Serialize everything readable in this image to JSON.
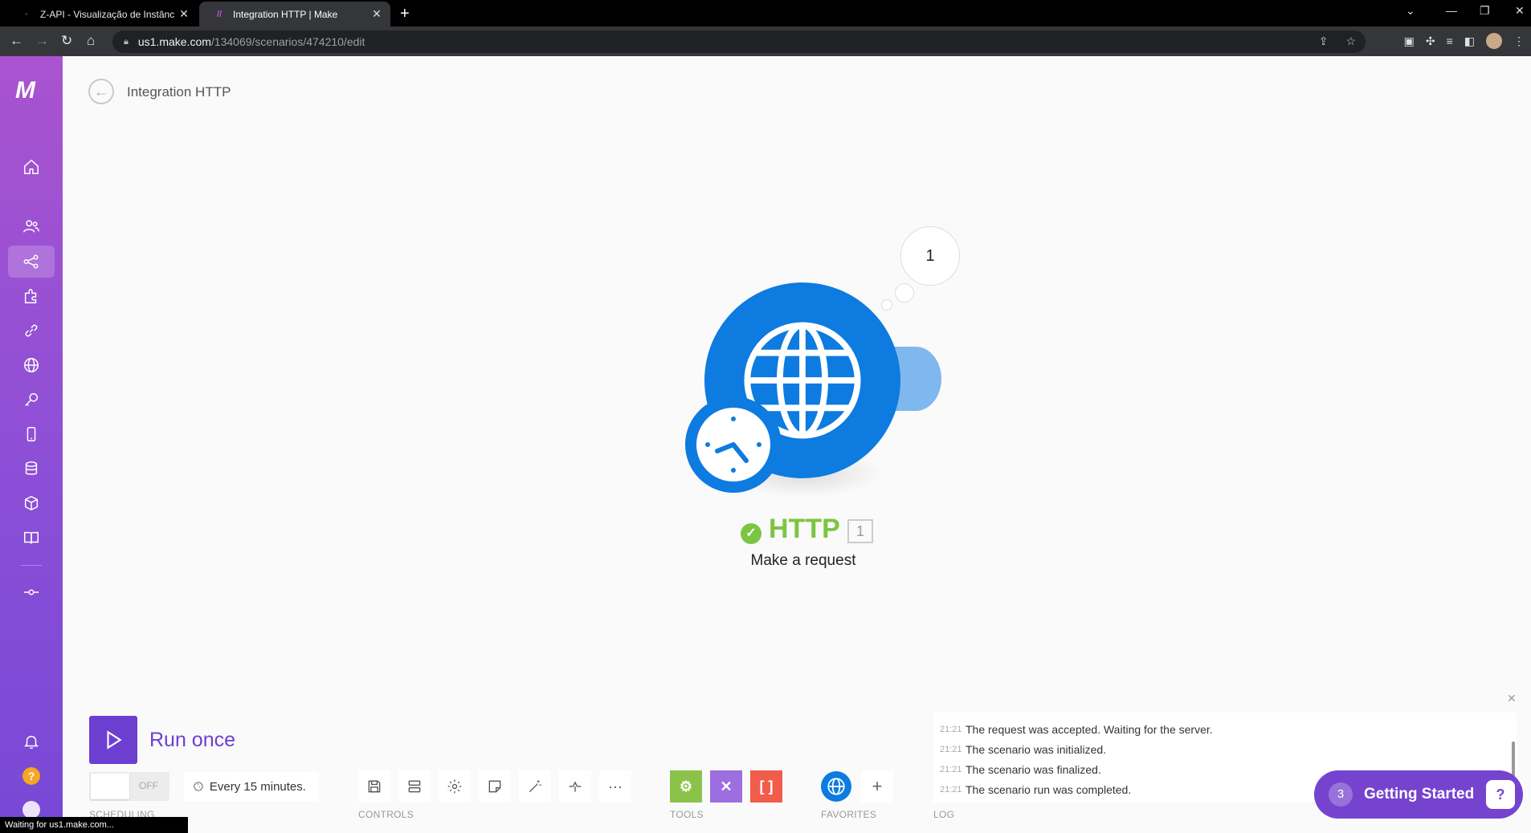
{
  "browser": {
    "tabs": [
      {
        "title": "Z-API - Visualização de Instância",
        "active": false
      },
      {
        "title": "Integration HTTP | Make",
        "active": true
      }
    ],
    "url_host": "us1.make.com",
    "url_path": "/134069/scenarios/474210/edit",
    "status_text": "Waiting for us1.make.com..."
  },
  "sidebar": {
    "logo": "M",
    "items": [
      {
        "icon": "home-icon"
      },
      {
        "icon": "team-icon"
      },
      {
        "icon": "scenarios-icon",
        "active": true
      },
      {
        "icon": "templates-icon"
      },
      {
        "icon": "connections-icon"
      },
      {
        "icon": "webhooks-icon"
      },
      {
        "icon": "keys-icon"
      },
      {
        "icon": "devices-icon"
      },
      {
        "icon": "datastores-icon"
      },
      {
        "icon": "datastructures-icon"
      },
      {
        "icon": "docs-icon"
      },
      {
        "icon": "flow-control-icon"
      }
    ],
    "help_label": "?"
  },
  "header": {
    "scenario_title": "Integration HTTP"
  },
  "module": {
    "bubble_count": "1",
    "name": "HTTP",
    "id": "1",
    "action": "Make a request",
    "colors": {
      "brand": "#0d7be0",
      "status_ok": "#7cc542"
    }
  },
  "toolbar": {
    "run_label": "Run once",
    "schedule_state": "OFF",
    "schedule_when": "Every 15 minutes.",
    "labels": {
      "scheduling": "SCHEDULING",
      "controls": "CONTROLS",
      "tools": "TOOLS",
      "favorites": "FAVORITES",
      "log": "LOG"
    },
    "controls": [
      "save-icon",
      "auto-align-icon",
      "settings-icon",
      "notes-icon",
      "magic-wand-icon",
      "explain-flow-icon",
      "more-icon"
    ],
    "tools": [
      {
        "icon": "tools-gear-icon",
        "color": "#8bc34a",
        "glyph": "⚙"
      },
      {
        "icon": "flow-control-tools-icon",
        "color": "#9c6ee0",
        "glyph": "✕"
      },
      {
        "icon": "text-parser-icon",
        "color": "#f25c4b",
        "glyph": "[ ]"
      }
    ],
    "favorites": [
      {
        "icon": "http-globe-icon",
        "color": "#0d7be0"
      },
      {
        "icon": "add-favorite-icon",
        "glyph": "+"
      }
    ]
  },
  "log": {
    "entries": [
      {
        "time": "21:21",
        "text": "The request was accepted. Waiting for the server."
      },
      {
        "time": "21:21",
        "text": "The scenario was initialized."
      },
      {
        "time": "21:21",
        "text": "The scenario was finalized."
      },
      {
        "time": "21:21",
        "text": "The scenario run was completed."
      }
    ]
  },
  "getting_started": {
    "count": "3",
    "label": "Getting Started"
  }
}
